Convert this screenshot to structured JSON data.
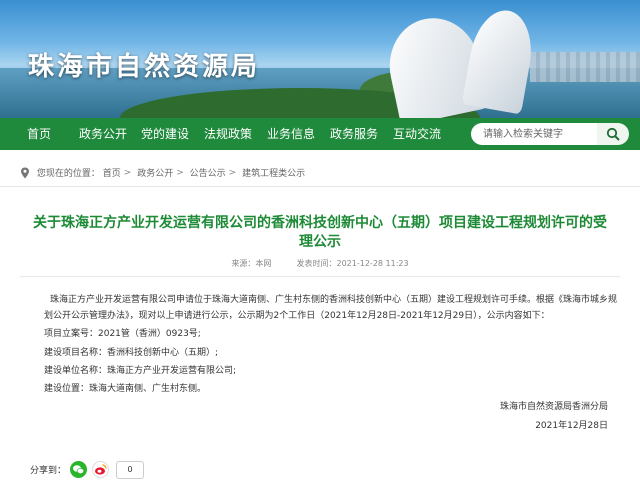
{
  "site": {
    "title": "珠海市自然资源局"
  },
  "nav": {
    "items": [
      "首页",
      "政务公开",
      "党的建设",
      "法规政策",
      "业务信息",
      "政务服务",
      "互动交流"
    ],
    "search_placeholder": "请输入检索关键字"
  },
  "breadcrumb": {
    "prefix": "您现在的位置：",
    "items": [
      "首页",
      "政务公开",
      "公告公示",
      "建筑工程类公示"
    ]
  },
  "article": {
    "title_line1": "关于珠海正方产业开发运营有限公司的香洲科技创新中心（五期）项目建设工程规划许可的受",
    "title_line2": "理公示",
    "source_label": "来源：",
    "source": "本网",
    "date_label": "发表时间：",
    "date": "2021-12-28 11:23",
    "paragraph": "珠海正方产业开发运营有限公司申请位于珠海大道南侧、广生村东侧的香洲科技创新中心（五期）建设工程规划许可手续。根据《珠海市城乡规划公开公示管理办法》，现对以上申请进行公示，公示期为2个工作日（2021年12月28日-2021年12月29日），公示内容如下：",
    "lines": [
      "项目立案号：2021管（香洲）0923号;",
      "建设项目名称：香洲科技创新中心（五期）;",
      "建设单位名称：珠海正方产业开发运营有限公司;",
      "建设位置：珠海大道南侧、广生村东侧。"
    ],
    "signature": "珠海市自然资源局香洲分局",
    "sign_date": "2021年12月28日"
  },
  "share": {
    "label": "分享到：",
    "count": "0"
  },
  "colors": {
    "nav": "#1f8a3c",
    "title": "#1d8a36"
  }
}
